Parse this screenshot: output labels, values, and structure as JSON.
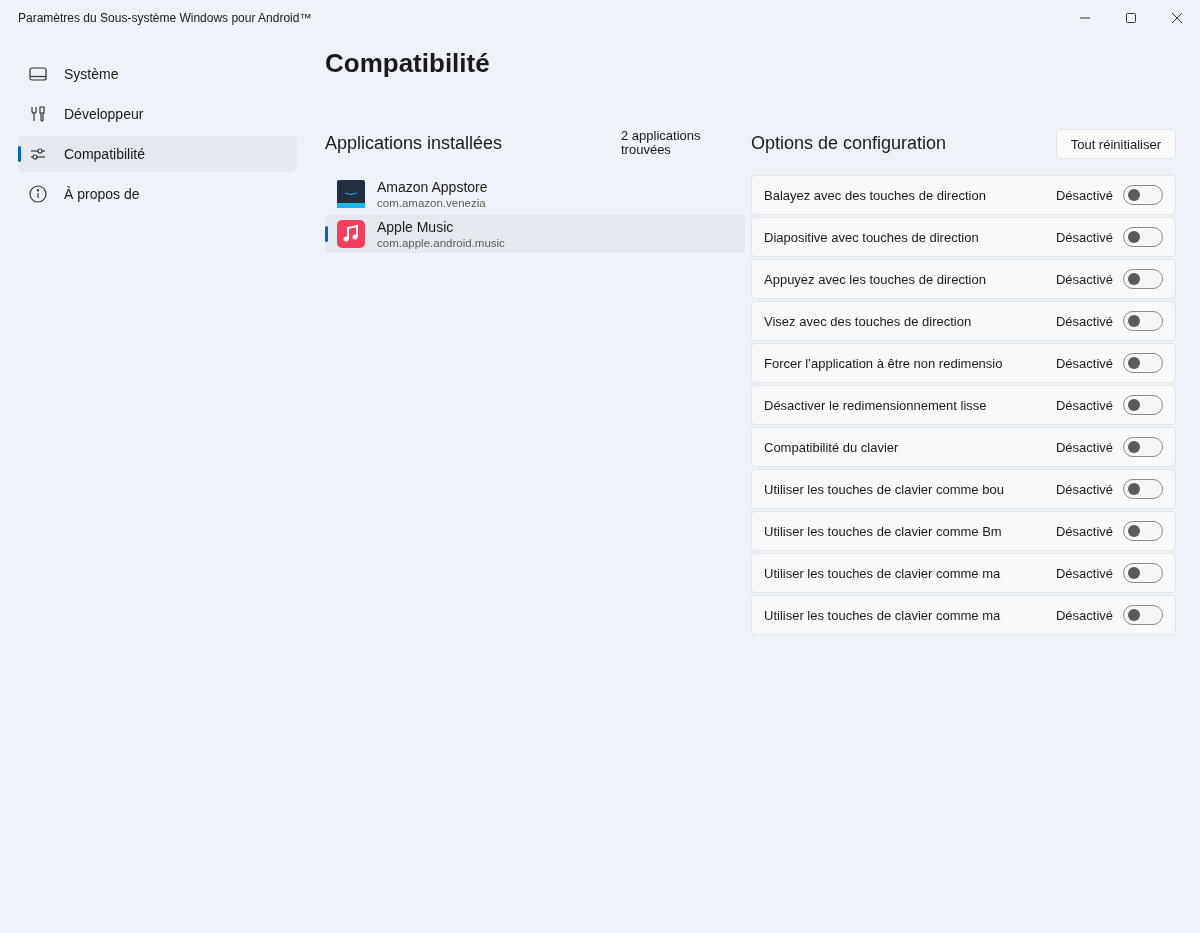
{
  "window": {
    "title": "Paramètres du Sous-système Windows pour Android™"
  },
  "sidebar": {
    "items": [
      {
        "label": "Système",
        "selected": false
      },
      {
        "label": "Développeur",
        "selected": false
      },
      {
        "label": "Compatibilité",
        "selected": true
      },
      {
        "label": "À propos de",
        "selected": false
      }
    ]
  },
  "page_title": "Compatibilité",
  "apps": {
    "heading": "Applications installées",
    "count": "2 applications trouvées",
    "items": [
      {
        "name": "Amazon Appstore",
        "package": "com.amazon.venezia",
        "selected": false
      },
      {
        "name": "Apple Music",
        "package": "com.apple.android.music",
        "selected": true
      }
    ]
  },
  "options": {
    "heading": "Options de configuration",
    "reset_button": "Tout réinitialiser",
    "items": [
      {
        "label": "Balayez avec des touches de direction",
        "state_text": "Désactivé",
        "on": false
      },
      {
        "label": "Diapositive avec touches de direction",
        "state_text": "Désactivé",
        "on": false
      },
      {
        "label": "Appuyez avec les touches de direction",
        "state_text": "Désactivé",
        "on": false
      },
      {
        "label": "Visez avec des touches de direction",
        "state_text": "Désactivé",
        "on": false
      },
      {
        "label": "Forcer l’application à être non redimensio",
        "state_text": "Désactivé",
        "on": false
      },
      {
        "label": "Désactiver le redimensionnement lisse",
        "state_text": "Désactivé",
        "on": false
      },
      {
        "label": "Compatibilité du clavier",
        "state_text": "Désactivé",
        "on": false
      },
      {
        "label": "Utiliser les touches de clavier comme bou",
        "state_text": "Désactivé",
        "on": false
      },
      {
        "label": "Utiliser les touches de clavier comme Bm",
        "state_text": "Désactivé",
        "on": false
      },
      {
        "label": "Utiliser les touches de clavier comme ma",
        "state_text": "Désactivé",
        "on": false
      },
      {
        "label": "Utiliser les touches de clavier comme ma",
        "state_text": "Désactivé",
        "on": false
      }
    ]
  }
}
